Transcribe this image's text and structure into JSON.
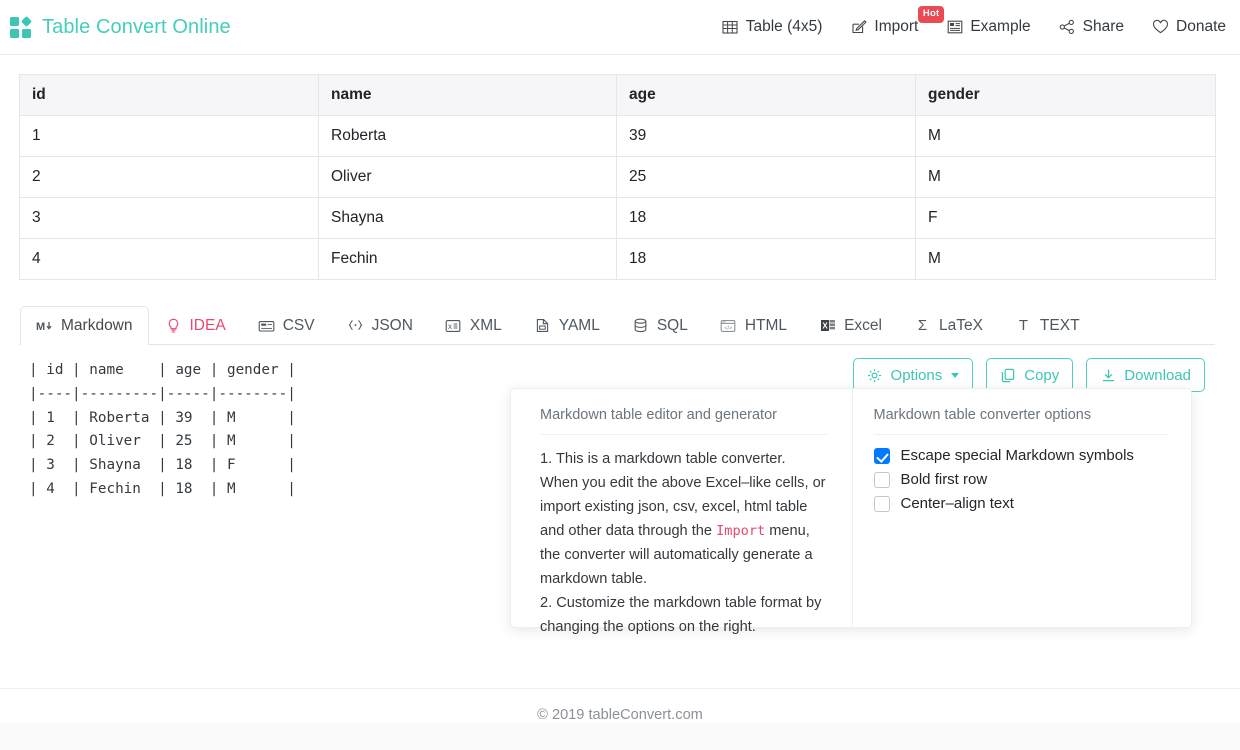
{
  "header": {
    "brand": "Table Convert Online",
    "logo_icon": "grid-squares-logo",
    "brand_color": "#46cdbb",
    "nav": [
      {
        "label": "Table (4x5)",
        "icon": "table-grid-icon",
        "badge": null
      },
      {
        "label": "Import",
        "icon": "edit-square-icon",
        "badge": "Hot",
        "badge_color": "#ea4b52"
      },
      {
        "label": "Example",
        "icon": "layout-example-icon",
        "badge": null
      },
      {
        "label": "Share",
        "icon": "share-nodes-icon",
        "badge": null
      },
      {
        "label": "Donate",
        "icon": "heart-icon",
        "badge": null
      }
    ]
  },
  "spreadsheet": {
    "columns": [
      "id",
      "name",
      "age",
      "gender"
    ],
    "rows": [
      [
        "1",
        "Roberta",
        "39",
        "M"
      ],
      [
        "2",
        "Oliver",
        "25",
        "M"
      ],
      [
        "3",
        "Shayna",
        "18",
        "F"
      ],
      [
        "4",
        "Fechin",
        "18",
        "M"
      ]
    ]
  },
  "tabs": [
    {
      "label": "Markdown",
      "icon": "markdown-m-down-icon",
      "glyph": "M↓",
      "active": true,
      "accent": null
    },
    {
      "label": "IDEA",
      "icon": "lightbulb-icon",
      "glyph": "○",
      "active": false,
      "accent": "#e8486f"
    },
    {
      "label": "CSV",
      "icon": "csv-file-icon",
      "glyph": "▤",
      "active": false,
      "accent": null
    },
    {
      "label": "JSON",
      "icon": "curly-braces-icon",
      "glyph": "{·}",
      "active": false,
      "accent": null
    },
    {
      "label": "XML",
      "icon": "xml-sheet-icon",
      "glyph": "▥",
      "active": false,
      "accent": null
    },
    {
      "label": "YAML",
      "icon": "yaml-file-icon",
      "glyph": "⌸",
      "active": false,
      "accent": null
    },
    {
      "label": "SQL",
      "icon": "database-icon",
      "glyph": "⌸",
      "active": false,
      "accent": null
    },
    {
      "label": "HTML",
      "icon": "browser-window-icon",
      "glyph": "⌧",
      "active": false,
      "accent": null
    },
    {
      "label": "Excel",
      "icon": "excel-icon",
      "glyph": "X",
      "active": false,
      "accent": null
    },
    {
      "label": "LaTeX",
      "icon": "sigma-icon",
      "glyph": "Σ",
      "active": false,
      "accent": null
    },
    {
      "label": "TEXT",
      "icon": "text-t-icon",
      "glyph": "T",
      "active": false,
      "accent": null
    }
  ],
  "output": {
    "format": "markdown",
    "text": "| id | name    | age | gender |\n|----|---------|-----|--------|\n| 1  | Roberta | 39  | M      |\n| 2  | Oliver  | 25  | M      |\n| 3  | Shayna  | 18  | F      |\n| 4  | Fechin  | 18  | M      |"
  },
  "actions": {
    "accent": "#3ec6b4",
    "options_label": "Options",
    "options_icon": "gear-icon",
    "copy_label": "Copy",
    "copy_icon": "copy-icon",
    "download_label": "Download",
    "download_icon": "download-arrow-icon"
  },
  "popover": {
    "left": {
      "title": "Markdown table editor and generator",
      "item1_part1": "1. This is a markdown table converter. When you edit the above Excel–like cells, or import existing json, csv, excel, html table and other data through the ",
      "item1_code": "Import",
      "item1_part2": " menu, the converter will automatically generate a markdown table.",
      "item2": "2. Customize the markdown table format by changing the options on the right."
    },
    "right": {
      "title": "Markdown table converter options",
      "options": [
        {
          "label": "Escape special Markdown symbols",
          "checked": true
        },
        {
          "label": "Bold first row",
          "checked": false
        },
        {
          "label": "Center–align text",
          "checked": false
        }
      ],
      "checked_color": "#007bff"
    }
  },
  "footer": {
    "copyright": "© 2019 tableConvert.com"
  }
}
